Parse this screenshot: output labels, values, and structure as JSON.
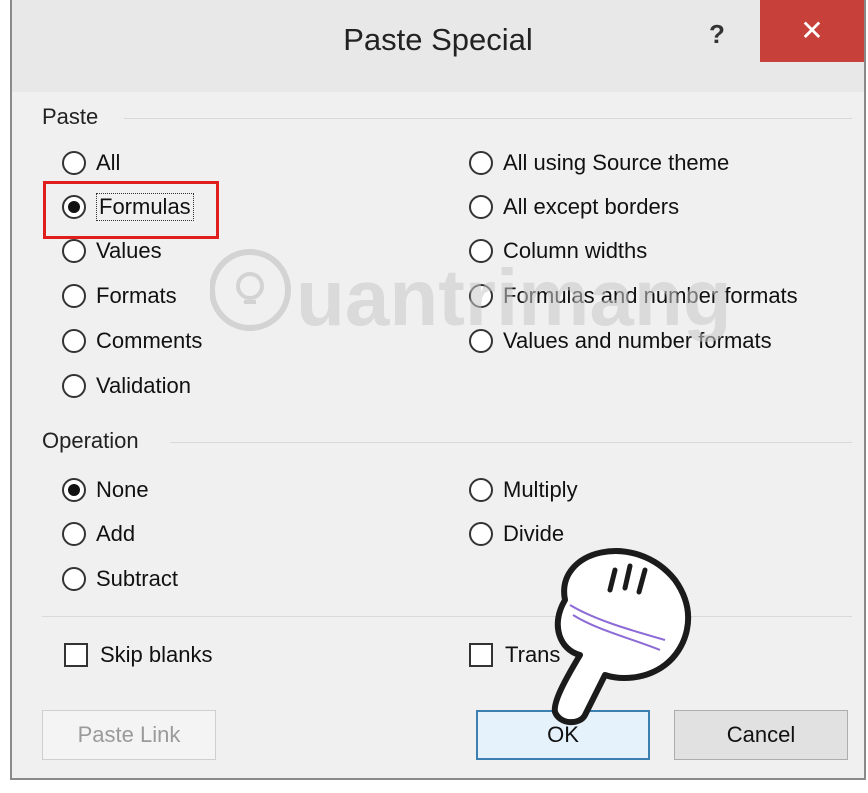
{
  "dialog": {
    "title": "Paste Special",
    "help": "?",
    "close": "✕"
  },
  "paste": {
    "label": "Paste",
    "left": [
      "All",
      "Formulas",
      "Values",
      "Formats",
      "Comments",
      "Validation"
    ],
    "right": [
      "All using Source theme",
      "All except borders",
      "Column widths",
      "Formulas and number formats",
      "Values and number formats"
    ],
    "selected": "Formulas"
  },
  "operation": {
    "label": "Operation",
    "left": [
      "None",
      "Add",
      "Subtract"
    ],
    "right": [
      "Multiply",
      "Divide"
    ],
    "selected": "None"
  },
  "checks": {
    "skip_blanks": "Skip blanks",
    "transpose": "Trans"
  },
  "buttons": {
    "paste_link": "Paste Link",
    "ok": "OK",
    "cancel": "Cancel"
  },
  "colors": {
    "highlight": "#e01e1e",
    "close_bg": "#c7403a",
    "default_border": "#3c7fb1"
  },
  "overlay": {
    "watermark": "Quantrimang",
    "hand_icon": "pointing-hand-icon"
  }
}
